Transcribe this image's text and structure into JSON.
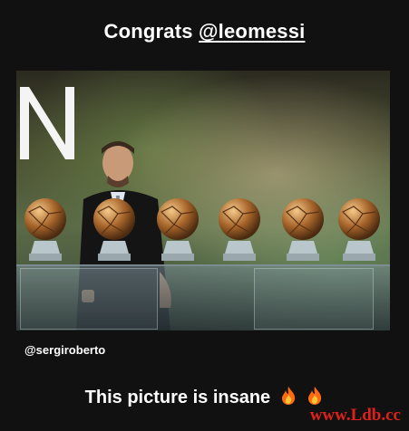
{
  "story": {
    "caption_prefix": "Congrats ",
    "caption_mention": "@leomessi",
    "photo_tag": "@sergiroberto",
    "bottom_caption": "This picture is insane",
    "emojis": [
      "fire-emoji",
      "fire-emoji"
    ],
    "watermark": "www.Ldb.cc"
  },
  "colors": {
    "background": "#111111",
    "text": "#ffffff",
    "watermark": "#e0201a"
  }
}
